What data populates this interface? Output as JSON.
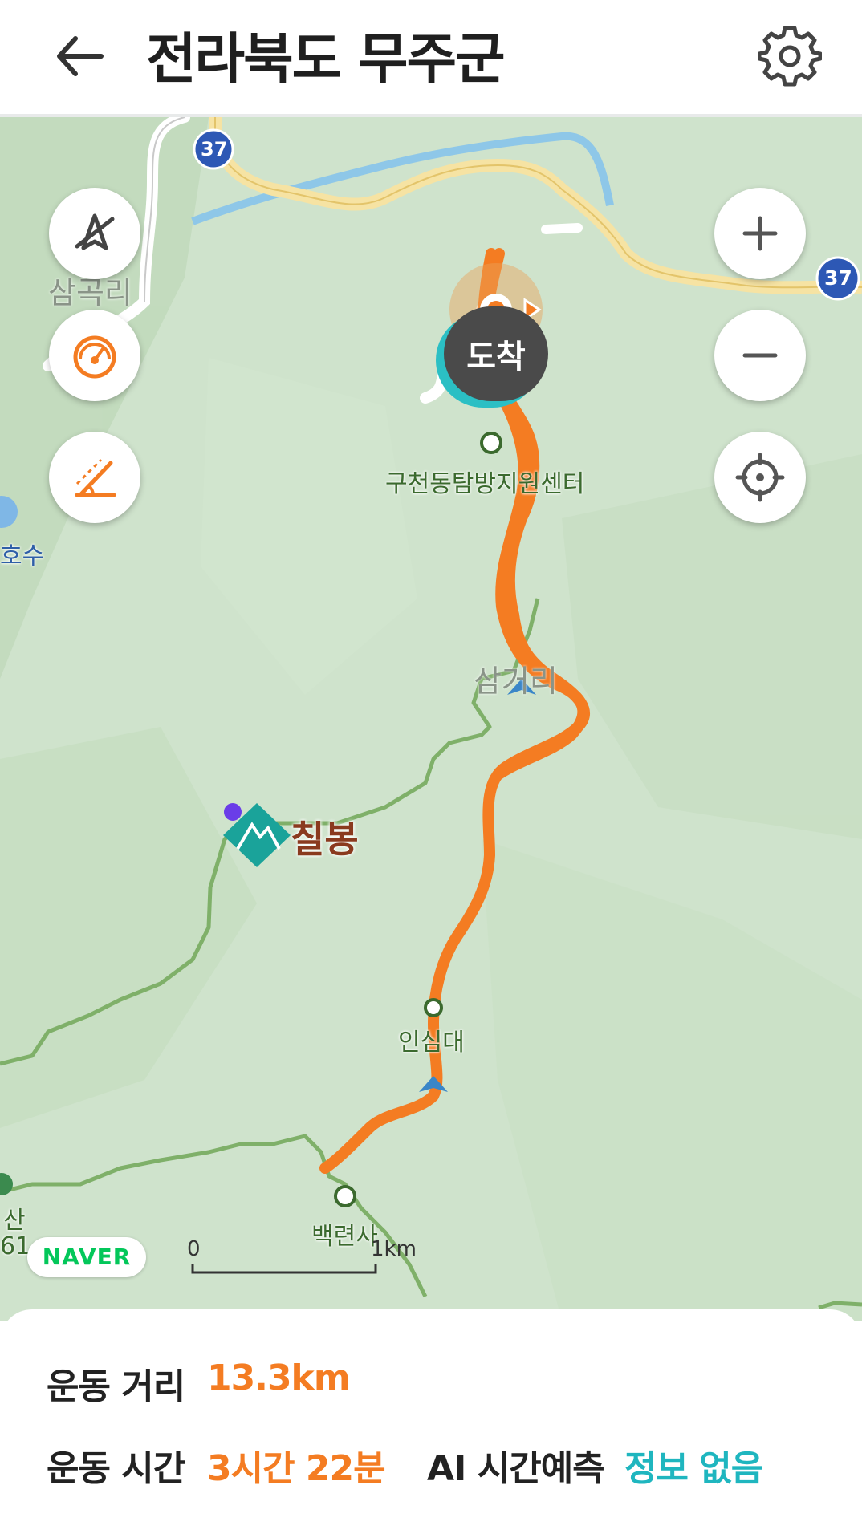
{
  "header": {
    "title": "전라북도 무주군"
  },
  "map": {
    "road_badges": [
      "37",
      "37"
    ],
    "labels": {
      "village_top_left": "삼곡리",
      "lake_left": "호수",
      "center": "구천동탐방지원센터",
      "samgeori": "삼거리",
      "peak": "칠봉",
      "insimdae": "인심대",
      "baekryeonsa": "백련사",
      "left_edge_mountain": "산",
      "left_edge_elev": "61"
    },
    "arrive_label": "도착",
    "naver": "NAVER",
    "scale": {
      "zero": "0",
      "km": "1km"
    }
  },
  "stats": {
    "distance_label": "운동 거리",
    "distance_value": "13.3km",
    "time_label": "운동 시간",
    "time_value": "3시간 22분",
    "ai_label": "AI 시간예측",
    "ai_value": "정보 없음"
  },
  "colors": {
    "route": "#f47c22",
    "accent_teal": "#1fb6bf",
    "map_bg": "#cfe3cc",
    "trail": "#7fb069"
  },
  "icons": {
    "back": "arrow-left-icon",
    "settings": "gear-icon",
    "compass_off": "compass-off-icon",
    "speedometer": "speedometer-icon",
    "slope": "slope-icon",
    "zoom_in": "plus-icon",
    "zoom_out": "minus-icon",
    "locate": "crosshair-icon"
  }
}
